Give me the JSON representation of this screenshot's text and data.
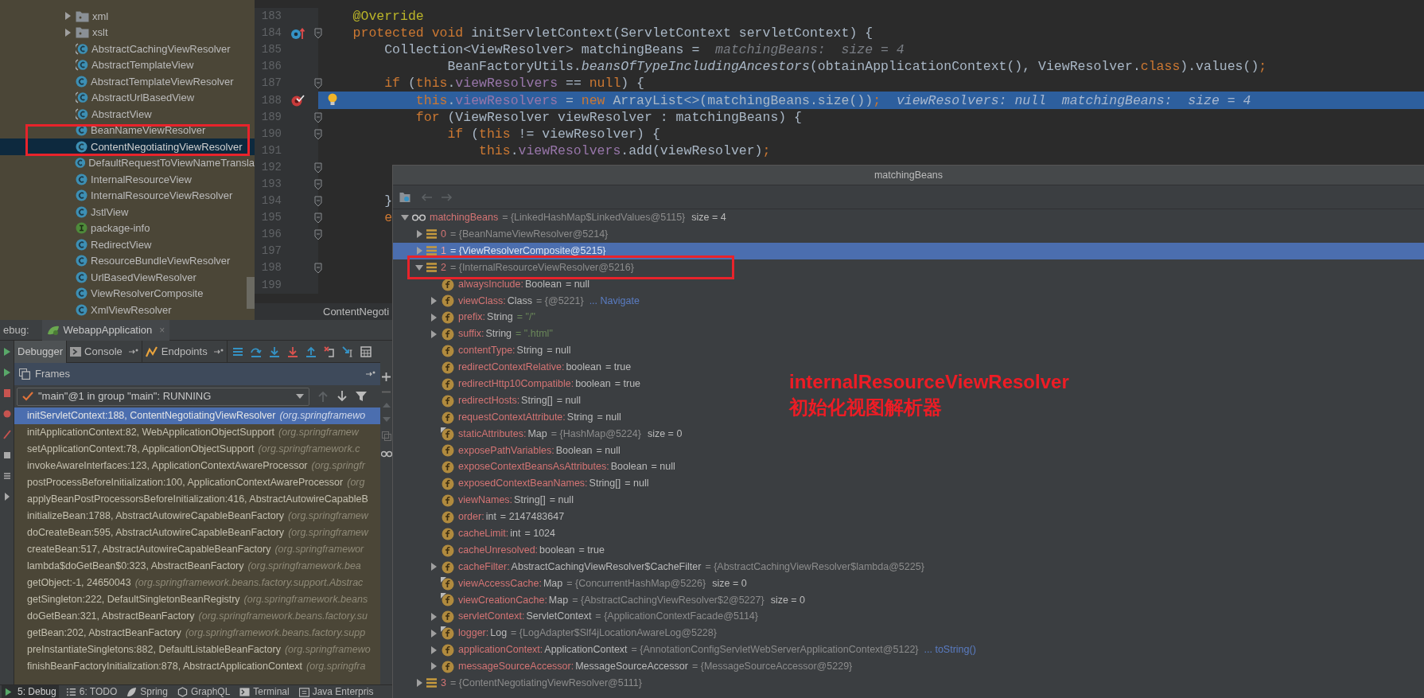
{
  "project_tree": {
    "items": [
      {
        "kind": "folder",
        "label": "xml",
        "expanded": false,
        "selected": false,
        "annotated": false
      },
      {
        "kind": "folder",
        "label": "xslt",
        "expanded": false,
        "selected": false,
        "annotated": false
      },
      {
        "kind": "abstract_class",
        "label": "AbstractCachingViewResolver",
        "selected": false,
        "annotated": false
      },
      {
        "kind": "abstract_class",
        "label": "AbstractTemplateView",
        "selected": false,
        "annotated": false
      },
      {
        "kind": "class",
        "label": "AbstractTemplateViewResolver",
        "selected": false,
        "annotated": false
      },
      {
        "kind": "abstract_class",
        "label": "AbstractUrlBasedView",
        "selected": false,
        "annotated": false
      },
      {
        "kind": "abstract_class",
        "label": "AbstractView",
        "selected": false,
        "annotated": false
      },
      {
        "kind": "class",
        "label": "BeanNameViewResolver",
        "selected": false,
        "annotated": true
      },
      {
        "kind": "class",
        "label": "ContentNegotiatingViewResolver",
        "selected": true,
        "annotated": true
      },
      {
        "kind": "class",
        "label": "DefaultRequestToViewNameTransla",
        "selected": false,
        "annotated": false
      },
      {
        "kind": "class",
        "label": "InternalResourceView",
        "selected": false,
        "annotated": false
      },
      {
        "kind": "class",
        "label": "InternalResourceViewResolver",
        "selected": false,
        "annotated": false
      },
      {
        "kind": "class",
        "label": "JstlView",
        "selected": false,
        "annotated": false
      },
      {
        "kind": "package_info",
        "label": "package-info",
        "selected": false,
        "annotated": false
      },
      {
        "kind": "class",
        "label": "RedirectView",
        "selected": false,
        "annotated": false
      },
      {
        "kind": "class",
        "label": "ResourceBundleViewResolver",
        "selected": false,
        "annotated": false
      },
      {
        "kind": "class",
        "label": "UrlBasedViewResolver",
        "selected": false,
        "annotated": false
      },
      {
        "kind": "class",
        "label": "ViewResolverComposite",
        "selected": false,
        "annotated": false
      },
      {
        "kind": "class",
        "label": "XmlViewResolver",
        "selected": false,
        "annotated": false
      }
    ]
  },
  "editor": {
    "lines": [
      {
        "number": "183",
        "override_marker": false,
        "breakpoint": false,
        "fold": false,
        "current": false,
        "bulb": false,
        "segments": [
          {
            "kind": "annotation",
            "text": "    @Override"
          }
        ]
      },
      {
        "number": "184",
        "override_marker": true,
        "breakpoint": false,
        "fold": true,
        "current": false,
        "bulb": false,
        "segments": [
          {
            "kind": "keyword",
            "text": "    protected void "
          },
          {
            "kind": "plain",
            "text": "initServletContext(ServletContext servletContext) {"
          }
        ]
      },
      {
        "number": "185",
        "override_marker": false,
        "breakpoint": false,
        "fold": false,
        "current": false,
        "bulb": false,
        "segments": [
          {
            "kind": "plain",
            "text": "        Collection<ViewResolver> matchingBeans =  "
          },
          {
            "kind": "hint",
            "text": "matchingBeans:  size = 4"
          }
        ]
      },
      {
        "number": "186",
        "override_marker": false,
        "breakpoint": false,
        "fold": false,
        "current": false,
        "bulb": false,
        "segments": [
          {
            "kind": "plain",
            "text": "                BeanFactoryUtils."
          },
          {
            "kind": "static",
            "text": "beansOfTypeIncludingAncestors"
          },
          {
            "kind": "plain",
            "text": "(obtainApplicationContext(), ViewResolver."
          },
          {
            "kind": "keyword",
            "text": "class"
          },
          {
            "kind": "plain",
            "text": ").values()"
          },
          {
            "kind": "keyword",
            "text": ";"
          }
        ]
      },
      {
        "number": "187",
        "override_marker": false,
        "breakpoint": false,
        "fold": true,
        "current": false,
        "bulb": false,
        "segments": [
          {
            "kind": "keyword",
            "text": "        if "
          },
          {
            "kind": "plain",
            "text": "("
          },
          {
            "kind": "keyword",
            "text": "this"
          },
          {
            "kind": "plain",
            "text": "."
          },
          {
            "kind": "field",
            "text": "viewResolvers"
          },
          {
            "kind": "plain",
            "text": " == "
          },
          {
            "kind": "keyword",
            "text": "null"
          },
          {
            "kind": "plain",
            "text": ") {"
          }
        ]
      },
      {
        "number": "188",
        "override_marker": false,
        "breakpoint": true,
        "fold": false,
        "current": true,
        "bulb": true,
        "segments": [
          {
            "kind": "keyword",
            "text": "            this"
          },
          {
            "kind": "plain",
            "text": "."
          },
          {
            "kind": "field",
            "text": "viewResolvers"
          },
          {
            "kind": "plain",
            "text": " = "
          },
          {
            "kind": "keyword",
            "text": "new "
          },
          {
            "kind": "plain",
            "text": "ArrayList<>(matchingBeans.size())"
          },
          {
            "kind": "keyword",
            "text": ";"
          },
          {
            "kind": "hint",
            "text": "  viewResolvers: null  matchingBeans:  size = 4"
          }
        ]
      },
      {
        "number": "189",
        "override_marker": false,
        "breakpoint": false,
        "fold": true,
        "current": false,
        "bulb": false,
        "segments": [
          {
            "kind": "keyword",
            "text": "            for "
          },
          {
            "kind": "plain",
            "text": "(ViewResolver viewResolver : matchingBeans) {"
          }
        ]
      },
      {
        "number": "190",
        "override_marker": false,
        "breakpoint": false,
        "fold": true,
        "current": false,
        "bulb": false,
        "segments": [
          {
            "kind": "keyword",
            "text": "                if "
          },
          {
            "kind": "plain",
            "text": "("
          },
          {
            "kind": "keyword",
            "text": "this"
          },
          {
            "kind": "plain",
            "text": " != viewResolver) {"
          }
        ]
      },
      {
        "number": "191",
        "override_marker": false,
        "breakpoint": false,
        "fold": false,
        "current": false,
        "bulb": false,
        "segments": [
          {
            "kind": "keyword",
            "text": "                    this"
          },
          {
            "kind": "plain",
            "text": "."
          },
          {
            "kind": "field",
            "text": "viewResolvers"
          },
          {
            "kind": "plain",
            "text": ".add(viewResolver)"
          },
          {
            "kind": "keyword",
            "text": ";"
          }
        ]
      },
      {
        "number": "192",
        "override_marker": false,
        "breakpoint": false,
        "fold": true,
        "current": false,
        "bulb": false
      },
      {
        "number": "193",
        "override_marker": false,
        "breakpoint": false,
        "fold": true,
        "current": false,
        "bulb": false
      },
      {
        "number": "194",
        "override_marker": false,
        "breakpoint": false,
        "fold": true,
        "current": false,
        "bulb": false,
        "segments": [
          {
            "kind": "plain",
            "text": "        }"
          }
        ]
      },
      {
        "number": "195",
        "override_marker": false,
        "breakpoint": false,
        "fold": true,
        "current": false,
        "bulb": false,
        "segments": [
          {
            "kind": "keyword",
            "text": "        e"
          }
        ]
      },
      {
        "number": "196",
        "override_marker": false,
        "breakpoint": false,
        "fold": true,
        "current": false,
        "bulb": false
      },
      {
        "number": "197",
        "override_marker": false,
        "breakpoint": false,
        "fold": false,
        "current": false,
        "bulb": false
      },
      {
        "number": "198",
        "override_marker": false,
        "breakpoint": false,
        "fold": true,
        "current": false,
        "bulb": false
      },
      {
        "number": "199",
        "override_marker": false,
        "breakpoint": false,
        "fold": false,
        "current": false,
        "bulb": false
      }
    ],
    "breadcrumb": "ContentNegoti"
  },
  "debug": {
    "label": "ebug:",
    "run_tab": {
      "label": "WebappApplication",
      "close": "×"
    },
    "tabs": [
      {
        "label": "Debugger",
        "pin": false,
        "selected": true
      },
      {
        "label": "Console",
        "pin": true,
        "selected": false
      },
      {
        "label": "Endpoints",
        "pin": true,
        "selected": false
      }
    ],
    "frames_title": "Frames",
    "thread": "\"main\"@1 in group \"main\": RUNNING",
    "frames": [
      {
        "method": "initServletContext:188, ContentNegotiatingViewResolver",
        "location": "(org.springframewo",
        "selected": true
      },
      {
        "method": "initApplicationContext:82, WebApplicationObjectSupport",
        "location": "(org.springframew",
        "selected": false
      },
      {
        "method": "setApplicationContext:78, ApplicationObjectSupport",
        "location": "(org.springframework.c",
        "selected": false
      },
      {
        "method": "invokeAwareInterfaces:123, ApplicationContextAwareProcessor",
        "location": "(org.springfr",
        "selected": false
      },
      {
        "method": "postProcessBeforeInitialization:100, ApplicationContextAwareProcessor",
        "location": "(org",
        "selected": false
      },
      {
        "method": "applyBeanPostProcessorsBeforeInitialization:416, AbstractAutowireCapableB",
        "selected": false
      },
      {
        "method": "initializeBean:1788, AbstractAutowireCapableBeanFactory",
        "location": "(org.springframew",
        "selected": false
      },
      {
        "method": "doCreateBean:595, AbstractAutowireCapableBeanFactory",
        "location": "(org.springframew",
        "selected": false
      },
      {
        "method": "createBean:517, AbstractAutowireCapableBeanFactory",
        "location": "(org.springframewor",
        "selected": false
      },
      {
        "method": "lambda$doGetBean$0:323, AbstractBeanFactory",
        "location": "(org.springframework.bea",
        "selected": false
      },
      {
        "method": "getObject:-1, 24650043",
        "location": "(org.springframework.beans.factory.support.Abstrac",
        "selected": false
      },
      {
        "method": "getSingleton:222, DefaultSingletonBeanRegistry",
        "location": "(org.springframework.beans",
        "selected": false
      },
      {
        "method": "doGetBean:321, AbstractBeanFactory",
        "location": "(org.springframework.beans.factory.su",
        "selected": false
      },
      {
        "method": "getBean:202, AbstractBeanFactory",
        "location": "(org.springframework.beans.factory.supp",
        "selected": false
      },
      {
        "method": "preInstantiateSingletons:882, DefaultListableBeanFactory",
        "location": "(org.springframewo",
        "selected": false
      },
      {
        "method": "finishBeanFactoryInitialization:878, AbstractApplicationContext",
        "location": "(org.springfra",
        "selected": false
      }
    ]
  },
  "status_bar": {
    "tabs": [
      {
        "kind": "debug",
        "label": "5: Debug",
        "selected": true
      },
      {
        "kind": "todo",
        "label": "6: TODO",
        "selected": false
      },
      {
        "kind": "spring",
        "label": "Spring",
        "selected": false
      },
      {
        "kind": "graphql",
        "label": "GraphQL",
        "selected": false
      },
      {
        "kind": "terminal",
        "label": "Terminal",
        "selected": false
      },
      {
        "kind": "javaee",
        "label": "Java Enterpris",
        "selected": false
      }
    ]
  },
  "popup": {
    "title": "matchingBeans",
    "root": {
      "kind": "watch",
      "name": "matchingBeans",
      "value": "= {LinkedHashMap$LinkedValues@5115}",
      "size": "size = 4",
      "expanded": true,
      "selected": false,
      "children": [
        {
          "kind": "element",
          "name": "0",
          "value": "= {BeanNameViewResolver@5214}",
          "expanded": false,
          "selected": false,
          "annotated": false
        },
        {
          "kind": "element",
          "name": "1",
          "value": "= {ViewResolverComposite@5215}",
          "expanded": false,
          "selected": true,
          "annotated": false
        },
        {
          "kind": "element",
          "name": "2",
          "value": "= {InternalResourceViewResolver@5216}",
          "expanded": true,
          "selected": false,
          "annotated": true,
          "children": [
            {
              "kind": "field",
              "name": "alwaysInclude:",
              "type": "Boolean",
              "value": "= null",
              "static": false,
              "selected": false
            },
            {
              "kind": "object_field",
              "name": "viewClass:",
              "type": "Class",
              "value": "= {@5221}",
              "link": "... Navigate",
              "static": false,
              "expanded": false,
              "selected": false
            },
            {
              "kind": "string_field",
              "name": "prefix:",
              "type": "String",
              "value": "= \"/\"",
              "static": false,
              "expanded": false,
              "selected": false
            },
            {
              "kind": "string_field",
              "name": "suffix:",
              "type": "String",
              "value": "= \".html\"",
              "static": false,
              "expanded": false,
              "selected": false
            },
            {
              "kind": "field",
              "name": "contentType:",
              "type": "String",
              "value": "= null",
              "static": false,
              "selected": false
            },
            {
              "kind": "field",
              "name": "redirectContextRelative:",
              "type": "boolean",
              "value": "= true",
              "static": false,
              "selected": false
            },
            {
              "kind": "field",
              "name": "redirectHttp10Compatible:",
              "type": "boolean",
              "value": "= true",
              "static": false,
              "selected": false
            },
            {
              "kind": "field",
              "name": "redirectHosts:",
              "type": "String[]",
              "value": "= null",
              "static": false,
              "selected": false
            },
            {
              "kind": "field",
              "name": "requestContextAttribute:",
              "type": "String",
              "value": "= null",
              "static": false,
              "selected": false
            },
            {
              "kind": "object_field",
              "name": "staticAttributes:",
              "type": "Map",
              "value": "= {HashMap@5224}",
              "size": "size = 0",
              "static": true,
              "selected": false
            },
            {
              "kind": "field",
              "name": "exposePathVariables:",
              "type": "Boolean",
              "value": "= null",
              "static": false,
              "selected": false
            },
            {
              "kind": "field",
              "name": "exposeContextBeansAsAttributes:",
              "type": "Boolean",
              "value": "= null",
              "static": false,
              "selected": false
            },
            {
              "kind": "field",
              "name": "exposedContextBeanNames:",
              "type": "String[]",
              "value": "= null",
              "static": false,
              "selected": false
            },
            {
              "kind": "field",
              "name": "viewNames:",
              "type": "String[]",
              "value": "= null",
              "static": false,
              "selected": false
            },
            {
              "kind": "field",
              "name": "order:",
              "type": "int",
              "value": "= 2147483647",
              "static": false,
              "selected": false
            },
            {
              "kind": "field",
              "name": "cacheLimit:",
              "type": "int",
              "value": "= 1024",
              "static": false,
              "selected": false
            },
            {
              "kind": "field",
              "name": "cacheUnresolved:",
              "type": "boolean",
              "value": "= true",
              "static": false,
              "selected": false
            },
            {
              "kind": "object_field",
              "name": "cacheFilter:",
              "type": "AbstractCachingViewResolver$CacheFilter",
              "value": "= {AbstractCachingViewResolver$lambda@5225}",
              "static": false,
              "expanded": false,
              "selected": false
            },
            {
              "kind": "object_field",
              "name": "viewAccessCache:",
              "type": "Map",
              "value": "= {ConcurrentHashMap@5226}",
              "size": "size = 0",
              "static": true,
              "selected": false
            },
            {
              "kind": "object_field",
              "name": "viewCreationCache:",
              "type": "Map",
              "value": "= {AbstractCachingViewResolver$2@5227}",
              "size": "size = 0",
              "static": true,
              "selected": false
            },
            {
              "kind": "object_field",
              "name": "servletContext:",
              "type": "ServletContext",
              "value": "= {ApplicationContextFacade@5114}",
              "static": false,
              "expanded": false,
              "selected": false
            },
            {
              "kind": "object_field",
              "name": "logger:",
              "type": "Log",
              "value": "= {LogAdapter$Slf4jLocationAwareLog@5228}",
              "static": true,
              "expanded": false,
              "selected": false
            },
            {
              "kind": "object_field",
              "name": "applicationContext:",
              "type": "ApplicationContext",
              "value": "= {AnnotationConfigServletWebServerApplicationContext@5122}",
              "link": "... toString()",
              "static": false,
              "expanded": false,
              "selected": false
            },
            {
              "kind": "object_field",
              "name": "messageSourceAccessor:",
              "type": "MessageSourceAccessor",
              "value": "= {MessageSourceAccessor@5229}",
              "static": false,
              "expanded": false,
              "selected": false
            }
          ]
        },
        {
          "kind": "element",
          "name": "3",
          "value": "= {ContentNegotiatingViewResolver@5111}",
          "expanded": false,
          "selected": false,
          "annotated": false
        }
      ]
    }
  },
  "annotation": [
    "internalResourceViewResolver",
    "初始化视图解析器"
  ]
}
